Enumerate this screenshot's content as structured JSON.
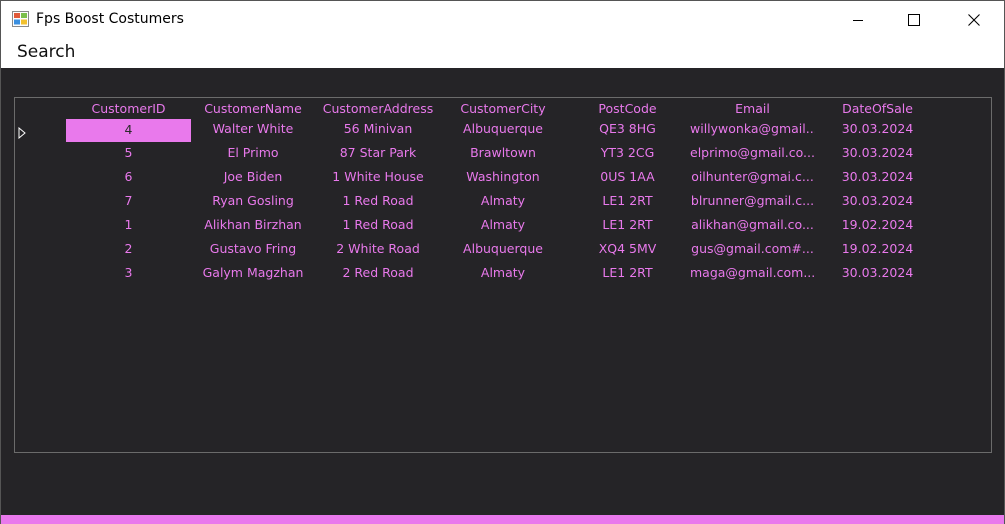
{
  "window": {
    "title": "Fps Boost Costumers"
  },
  "menu": {
    "search_label": "Search"
  },
  "colors": {
    "accent": "#e979ec",
    "background": "#252427",
    "titlebar": "#ffffff"
  },
  "grid": {
    "columns": [
      "CustomerID",
      "CustomerName",
      "CustomerAddress",
      "CustomerCity",
      "PostCode",
      "Email",
      "DateOfSale"
    ],
    "rows": [
      [
        "4",
        "Walter White",
        "56 Minivan",
        "Albuquerque",
        "QE3 8HG",
        "willywonka@gmail....",
        "30.03.2024"
      ],
      [
        "5",
        "El Primo",
        "87 Star Park",
        "Brawltown",
        "YT3 2CG",
        "elprimo@gmail.co...",
        "30.03.2024"
      ],
      [
        "6",
        "Joe Biden",
        "1 White House",
        "Washington",
        "0US 1AA",
        "oilhunter@gmai.c...",
        "30.03.2024"
      ],
      [
        "7",
        "Ryan Gosling",
        "1 Red Road",
        "Almaty",
        "LE1 2RT",
        "blrunner@gmail.c...",
        "30.03.2024"
      ],
      [
        "1",
        "Alikhan Birzhan",
        "1 Red Road",
        "Almaty",
        "LE1 2RT",
        "alikhan@gmail.co...",
        "19.02.2024"
      ],
      [
        "2",
        "Gustavo Fring",
        "2 White Road",
        "Albuquerque",
        "XQ4 5MV",
        "gus@gmail.com#...",
        "19.02.2024"
      ],
      [
        "3",
        "Galym Magzhan",
        "2 Red Road",
        "Almaty",
        "LE1 2RT",
        "maga@gmail.com...",
        "30.03.2024"
      ]
    ],
    "selected_row": 0,
    "selected_col": 0
  },
  "icons": {
    "app": "app-windows-icon",
    "minimize": "minimize-icon",
    "maximize": "maximize-icon",
    "close": "close-icon",
    "row_indicator": "row-pointer-icon"
  }
}
